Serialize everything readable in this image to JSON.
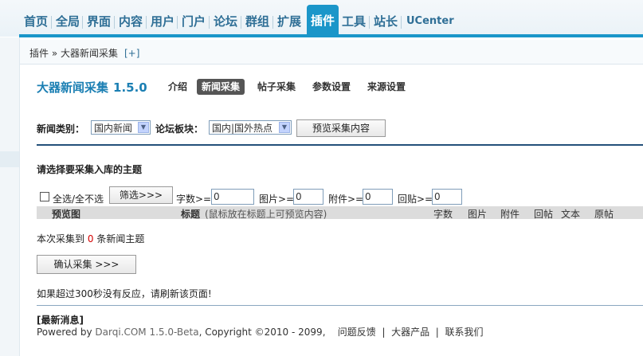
{
  "nav": {
    "items": [
      "首页",
      "全局",
      "界面",
      "内容",
      "用户",
      "门户",
      "论坛",
      "群组",
      "扩展",
      "插件",
      "工具",
      "站长",
      "UCenter"
    ],
    "active": "插件"
  },
  "breadcrumb": {
    "text": "插件 » 大器新闻采集",
    "plus": "[+]"
  },
  "header": {
    "title": "大器新闻采集",
    "version": "1.5.0",
    "tabs": [
      "介绍",
      "新闻采集",
      "帖子采集",
      "参数设置",
      "来源设置"
    ],
    "active_tab": "新闻采集"
  },
  "form": {
    "category_label": "新闻类别：",
    "category_value": "国内新闻",
    "board_label": "论坛板块：",
    "board_value": "国内|国外热点",
    "preview_button": "预览采集内容"
  },
  "select_section": {
    "heading": "请选择要采集入库的主题",
    "select_all": "全选/全不选",
    "filter_button": "筛选>>>",
    "words_label": "字数>=",
    "words_value": "0",
    "images_label": "图片>=",
    "images_value": "0",
    "attach_label": "附件>=",
    "attach_value": "0",
    "replies_label": "回贴>=",
    "replies_value": "0"
  },
  "table": {
    "col_preview": "预览图",
    "col_title": "标题",
    "col_title_hint": "(鼠标放在标题上可预览内容)",
    "col_words": "字数",
    "col_images": "图片",
    "col_attach": "附件",
    "col_replies": "回帖",
    "col_text": "文本",
    "col_original": "原帖"
  },
  "result": {
    "prefix": "本次采集到",
    "count": "0",
    "suffix": "条新闻主题"
  },
  "confirm_button": "确认采集 >>>",
  "timeout_note": "如果超过300秒没有反应，请刷新该页面!",
  "footer": {
    "news_title": "[最新消息]",
    "powered_prefix": "Powered by",
    "brand": "Darqi.COM 1.5.0-Beta",
    "copyright": ", Copyright ©2010 - 2099,",
    "link_feedback": "问题反馈",
    "link_products": "大器产品",
    "link_contact": "联系我们"
  },
  "colors": {
    "accent": "#1b96c9",
    "nav_text": "#2f6f96",
    "rule": "#23507a",
    "count_red": "#d40000"
  }
}
